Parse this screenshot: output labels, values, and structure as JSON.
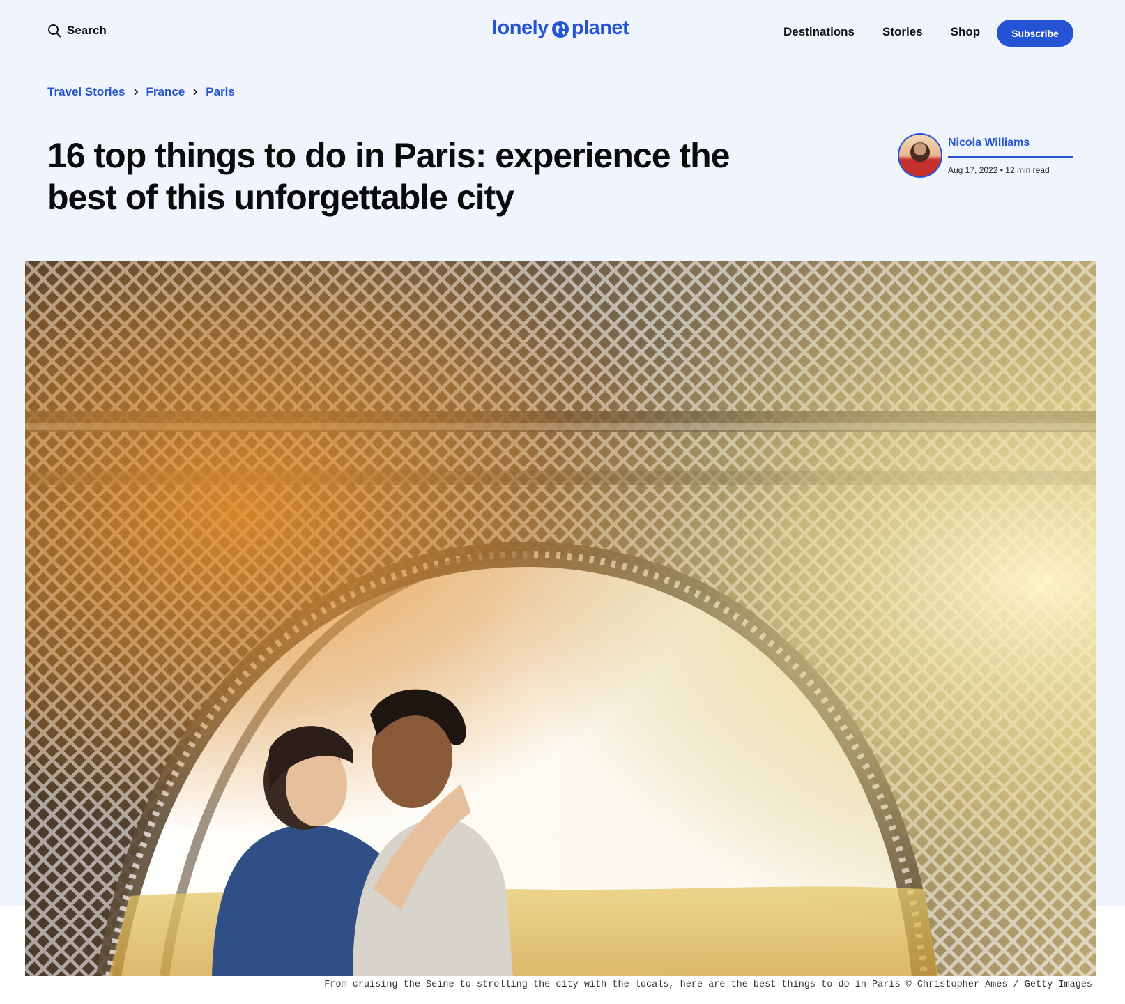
{
  "header": {
    "search_label": "Search",
    "logo_left": "lonely",
    "logo_right": "planet",
    "nav": [
      "Destinations",
      "Stories",
      "Shop"
    ],
    "subscribe_label": "Subscribe",
    "brand_color": "#2453d4"
  },
  "breadcrumb": [
    "Travel Stories",
    "France",
    "Paris"
  ],
  "article": {
    "title": "16 top things to do in Paris: experience the best of this unforgettable city",
    "author": "Nicola Williams",
    "meta": "Aug 17, 2022 • 12 min read"
  },
  "hero": {
    "caption": "From cruising the Seine to strolling the city with the locals, here are the best things to do in Paris © Christopher Ames / Getty Images"
  },
  "icons": {
    "search": "search-icon",
    "logo": "globe-icon",
    "breadcrumb_separator": "chevron-right-icon"
  }
}
